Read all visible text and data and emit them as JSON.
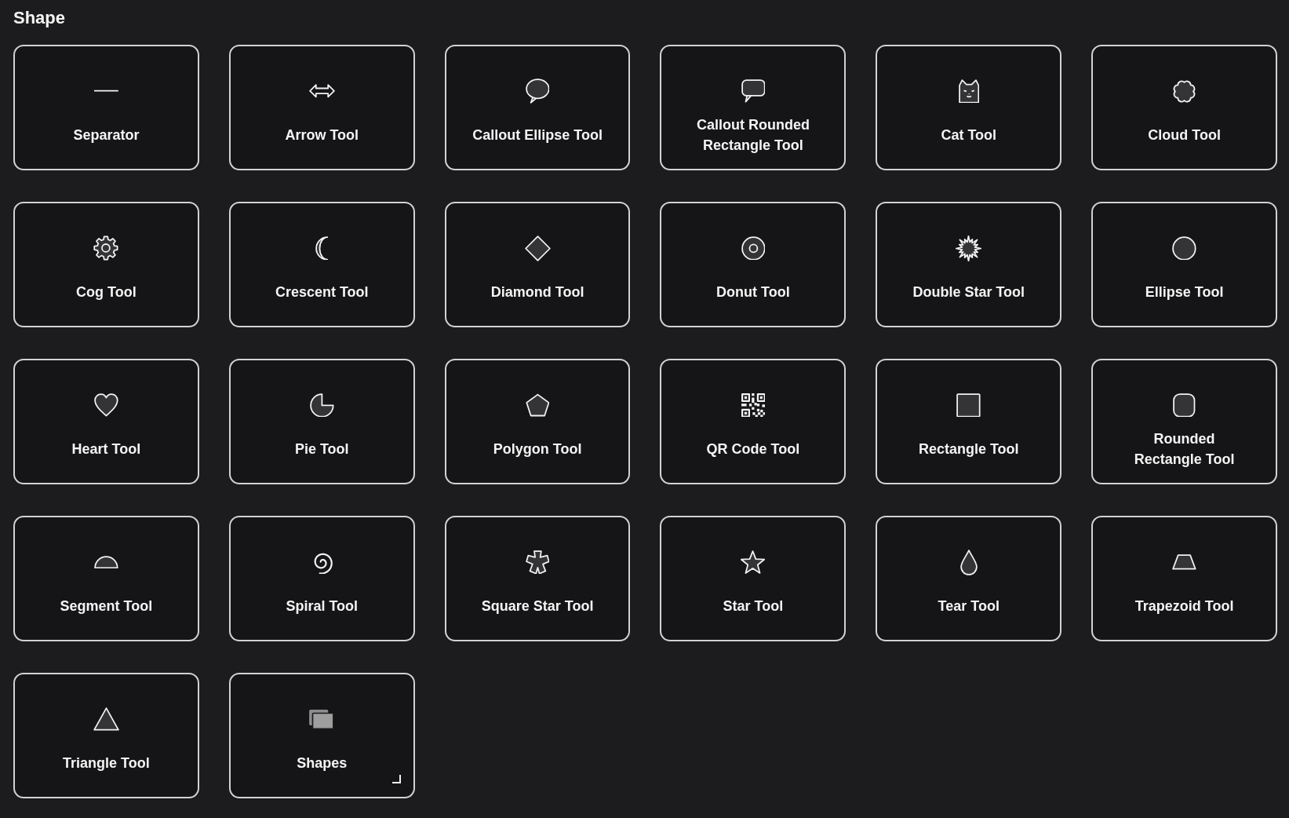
{
  "panel": {
    "title": "Shape"
  },
  "tools": [
    {
      "label": "Separator",
      "kind": "line",
      "expandable": false
    },
    {
      "label": "Arrow Tool",
      "kind": "arrow",
      "expandable": false
    },
    {
      "label": "Callout Ellipse Tool",
      "kind": "bubble",
      "expandable": false
    },
    {
      "label": "Callout Rounded Rectangle Tool",
      "kind": "roundbubble",
      "expandable": false
    },
    {
      "label": "Cat Tool",
      "kind": "cat",
      "expandable": false
    },
    {
      "label": "Cloud Tool",
      "kind": "cloud",
      "expandable": false
    },
    {
      "label": "Cog Tool",
      "kind": "cog",
      "expandable": false
    },
    {
      "label": "Crescent Tool",
      "kind": "crescent",
      "expandable": false
    },
    {
      "label": "Diamond Tool",
      "kind": "diamond",
      "expandable": false
    },
    {
      "label": "Donut Tool",
      "kind": "donut",
      "expandable": false
    },
    {
      "label": "Double Star Tool",
      "kind": "burst",
      "expandable": false
    },
    {
      "label": "Ellipse Tool",
      "kind": "ellipse",
      "expandable": false
    },
    {
      "label": "Heart Tool",
      "kind": "heart",
      "expandable": false
    },
    {
      "label": "Pie Tool",
      "kind": "pie",
      "expandable": false
    },
    {
      "label": "Polygon Tool",
      "kind": "polygon",
      "expandable": false
    },
    {
      "label": "QR Code Tool",
      "kind": "qrcode",
      "expandable": false
    },
    {
      "label": "Rectangle Tool",
      "kind": "rectangle",
      "expandable": false
    },
    {
      "label": "Rounded Rectangle Tool",
      "kind": "roundrect",
      "expandable": false
    },
    {
      "label": "Segment Tool",
      "kind": "segment",
      "expandable": false
    },
    {
      "label": "Spiral Tool",
      "kind": "spiral",
      "expandable": false
    },
    {
      "label": "Square Star Tool",
      "kind": "squarestar",
      "expandable": false
    },
    {
      "label": "Star Tool",
      "kind": "star",
      "expandable": false
    },
    {
      "label": "Tear Tool",
      "kind": "tear",
      "expandable": false
    },
    {
      "label": "Trapezoid Tool",
      "kind": "trapezoid",
      "expandable": false
    },
    {
      "label": "Triangle Tool",
      "kind": "triangle",
      "expandable": false
    },
    {
      "label": "Shapes",
      "kind": "stack",
      "expandable": true
    }
  ]
}
